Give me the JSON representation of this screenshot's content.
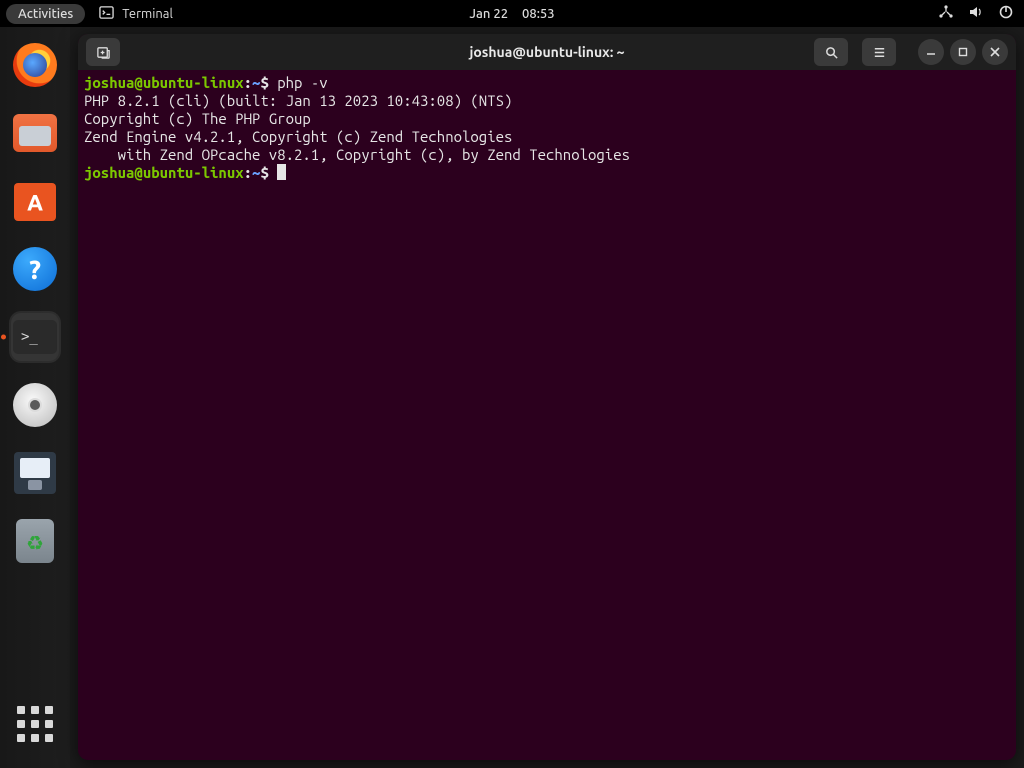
{
  "topbar": {
    "activities": "Activities",
    "app_label": "Terminal",
    "date": "Jan 22",
    "time": "08:53"
  },
  "dock": {
    "items": [
      {
        "name": "firefox"
      },
      {
        "name": "files"
      },
      {
        "name": "software"
      },
      {
        "name": "help"
      },
      {
        "name": "terminal"
      },
      {
        "name": "disks"
      },
      {
        "name": "save"
      },
      {
        "name": "trash"
      }
    ]
  },
  "terminal": {
    "title": "joshua@ubuntu-linux: ~",
    "prompt": {
      "user": "joshua",
      "host": "ubuntu-linux",
      "at": "@",
      "sep1": ":",
      "path": "~",
      "sigil": "$"
    },
    "command1": "php -v",
    "output": [
      "PHP 8.2.1 (cli) (built: Jan 13 2023 10:43:08) (NTS)",
      "Copyright (c) The PHP Group",
      "Zend Engine v4.2.1, Copyright (c) Zend Technologies",
      "    with Zend OPcache v8.2.1, Copyright (c), by Zend Technologies"
    ]
  }
}
